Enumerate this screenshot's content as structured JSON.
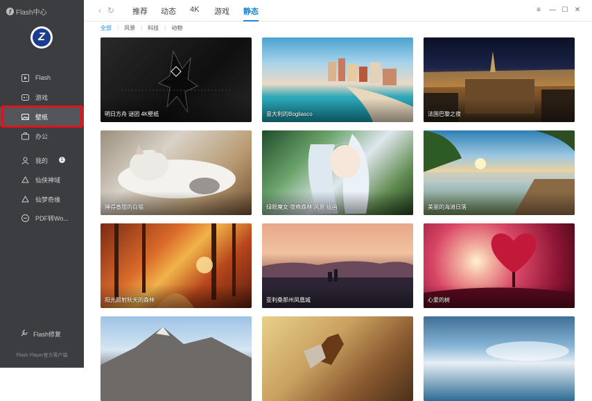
{
  "app": {
    "brand": "Flash中心"
  },
  "sidebar": {
    "items": [
      {
        "label": "Flash",
        "icon": "play-icon"
      },
      {
        "label": "游戏",
        "icon": "gamepad-icon"
      },
      {
        "label": "壁纸",
        "icon": "image-icon",
        "active": true
      },
      {
        "label": "办公",
        "icon": "briefcase-icon"
      },
      {
        "label": "我的",
        "icon": "user-icon",
        "badge": "1"
      },
      {
        "label": "仙侠神域",
        "icon": "game-link-icon"
      },
      {
        "label": "仙梦奇缘",
        "icon": "game-link-icon"
      },
      {
        "label": "PDF转Wo...",
        "icon": "pdf-icon"
      }
    ],
    "repair_label": "Flash修复",
    "footer": "Flash Player官方客户端"
  },
  "topbar": {
    "tabs": [
      "推荐",
      "动态",
      "4K",
      "游戏",
      "静态"
    ],
    "active_tab": "静态"
  },
  "subtabs": {
    "items": [
      "全部",
      "风景",
      "科技",
      "动物"
    ],
    "active": "全部"
  },
  "wallpapers": [
    {
      "caption": "明日方舟 谜团 4K壁纸"
    },
    {
      "caption": "意大利的Bogliasco"
    },
    {
      "caption": "法国巴黎之夜"
    },
    {
      "caption": "睡得香甜的白猫"
    },
    {
      "caption": "绿眼魔女 夜晚森林 风景 插画"
    },
    {
      "caption": "美丽的海滩日落"
    },
    {
      "caption": "阳光照射秋天的森林"
    },
    {
      "caption": "亚利桑那州凤凰城"
    },
    {
      "caption": "心爱的树"
    },
    {
      "caption": ""
    },
    {
      "caption": ""
    },
    {
      "caption": ""
    }
  ],
  "colors": {
    "sidebar_bg": "#3c3d41",
    "accent": "#1e88d8",
    "highlight_border": "#e1141b"
  }
}
